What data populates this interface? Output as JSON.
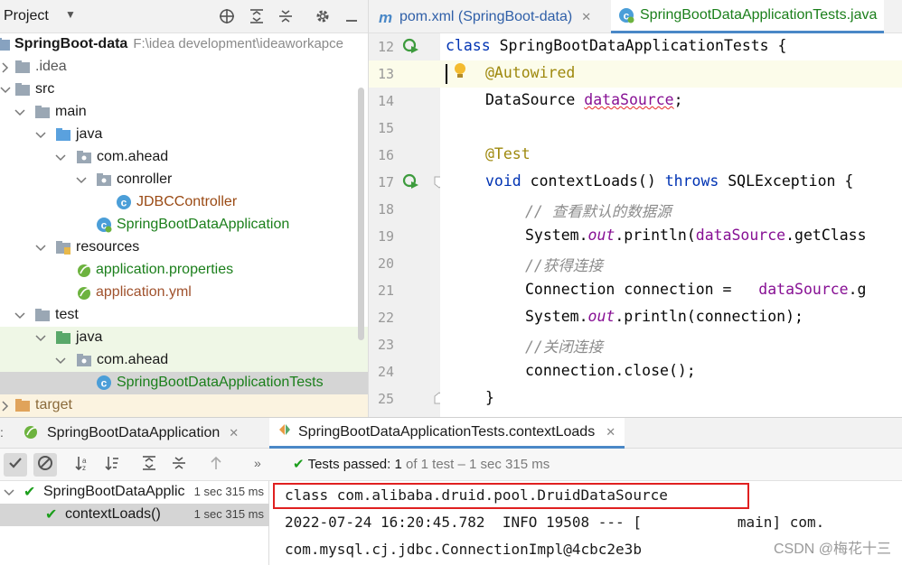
{
  "project_panel": {
    "title": "Project",
    "tree": [
      {
        "label": "SpringBoot-data",
        "path": "F:\\idea development\\ideaworkapce"
      },
      {
        "label": ".idea"
      },
      {
        "label": "src"
      },
      {
        "label": "main"
      },
      {
        "label": "java"
      },
      {
        "label": "com.ahead"
      },
      {
        "label": "conroller"
      },
      {
        "label": "JDBCController"
      },
      {
        "label": "SpringBootDataApplication"
      },
      {
        "label": "resources"
      },
      {
        "label": "application.properties"
      },
      {
        "label": "application.yml"
      },
      {
        "label": "test"
      },
      {
        "label": "java"
      },
      {
        "label": "com.ahead"
      },
      {
        "label": "SpringBootDataApplicationTests"
      },
      {
        "label": "target"
      }
    ]
  },
  "editor_tabs": [
    {
      "label": "pom.xml (SpringBoot-data)"
    },
    {
      "label": "SpringBootDataApplicationTests.java"
    }
  ],
  "editor": {
    "line_numbers": [
      "12",
      "13",
      "14",
      "15",
      "16",
      "17",
      "18",
      "19",
      "20",
      "21",
      "22",
      "23",
      "24",
      "25"
    ],
    "lines": {
      "l12_kw": "class",
      "l12_rest": " SpringBootDataApplicationTests {",
      "l13": "@Autowired",
      "l14_type": "DataSource ",
      "l14_field": "dataSource",
      "l14_end": ";",
      "l16": "@Test",
      "l17_kw1": "void",
      "l17_mid": " contextLoads() ",
      "l17_kw2": "throws",
      "l17_rest": " SQLException {",
      "l18": "// 查看默认的数据源",
      "l19_a": "System.",
      "l19_out": "out",
      "l19_b": ".println(",
      "l19_field": "dataSource",
      "l19_c": ".getClass",
      "l20": "//获得连接",
      "l21_a": "Connection connection =   ",
      "l21_field": "dataSource",
      "l21_b": ".g",
      "l22_a": "System.",
      "l22_out": "out",
      "l22_b": ".println(connection);",
      "l23": "//关闭连接",
      "l24": "connection.close();",
      "l25": "}"
    }
  },
  "run_panel": {
    "tabs": [
      {
        "label": "SpringBootDataApplication"
      },
      {
        "label": "SpringBootDataApplicationTests.contextLoads"
      }
    ],
    "status": {
      "prefix": "Tests passed: ",
      "count": "1",
      "detail": " of 1 test – 1 sec 315 ms"
    },
    "results": [
      {
        "label": "SpringBootDataApplic",
        "time": "1 sec 315 ms"
      },
      {
        "label": "contextLoads()",
        "time": "1 sec 315 ms"
      }
    ],
    "console": [
      "class com.alibaba.druid.pool.DruidDataSource",
      "2022-07-24 16:20:45.782  INFO 19508 --- [           main] com.",
      "com.mysql.cj.jdbc.ConnectionImpl@4cbc2e3b"
    ]
  },
  "watermark": "CSDN @梅花十三",
  "colors": {
    "keyword": "#0033b3",
    "annotation": "#9e880d",
    "field": "#871094",
    "comment": "#8c8c8c",
    "test_pass": "#1b9e1b",
    "highlight_box": "#e02020"
  },
  "icons": [
    "m-icon",
    "c-class-icon",
    "spring-run-icon",
    "folder-icon",
    "module-icon",
    "resources-folder-icon",
    "spring-config-icon",
    "check-icon",
    "stop-icon",
    "gear-icon",
    "crosshair-icon",
    "expand-icon",
    "collapse-icon",
    "lightbulb-icon",
    "sort-icon",
    "arrow-up-icon"
  ]
}
